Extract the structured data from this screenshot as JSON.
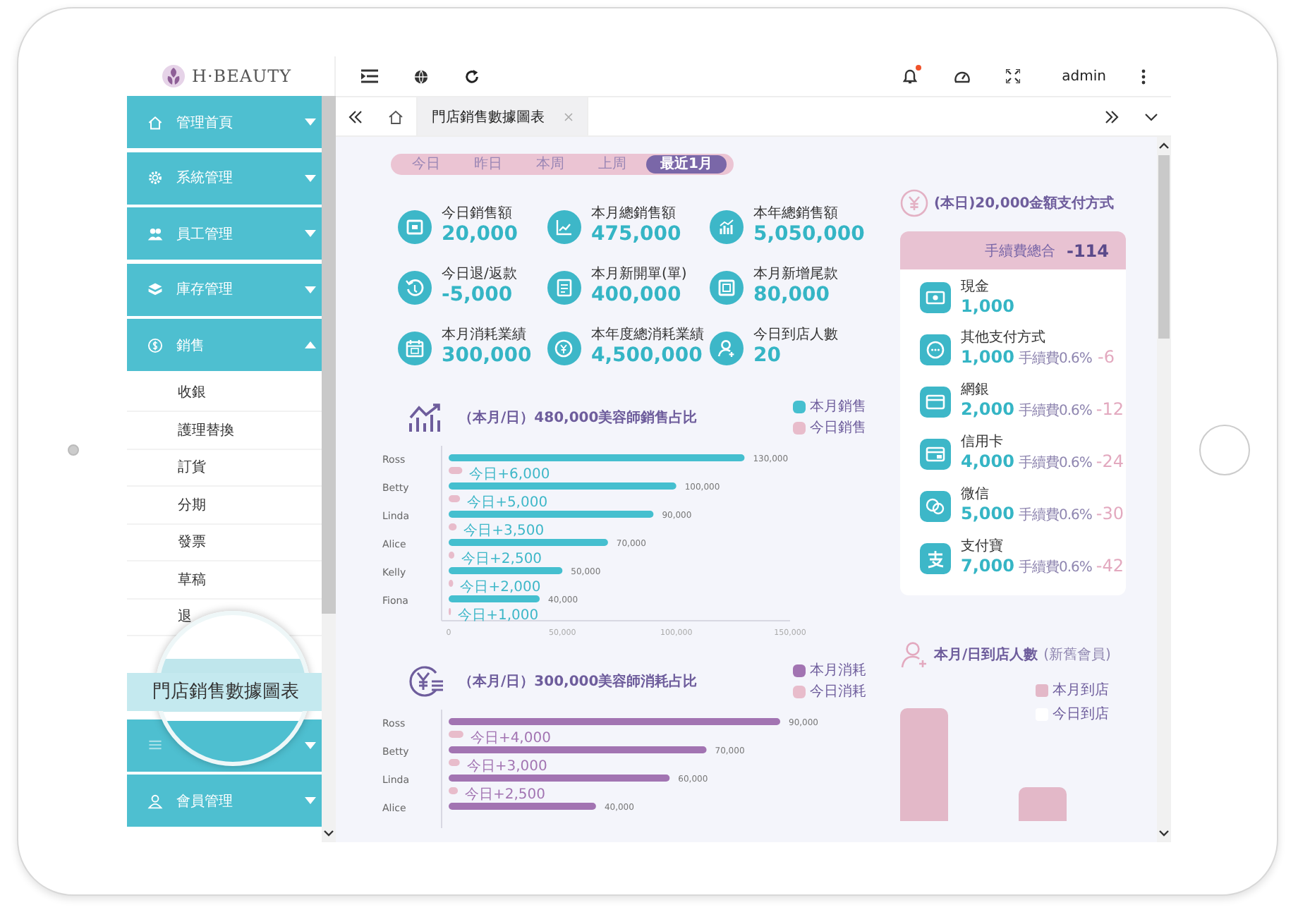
{
  "header": {
    "logo_text": "H·BEAUTY",
    "user": "admin",
    "has_notification": true
  },
  "sidebar": {
    "items": [
      {
        "label": "管理首頁",
        "expanded": false
      },
      {
        "label": "系統管理",
        "expanded": false
      },
      {
        "label": "員工管理",
        "expanded": false
      },
      {
        "label": "庫存管理",
        "expanded": false
      },
      {
        "label": "銷售",
        "expanded": true,
        "children": [
          {
            "label": "收銀",
            "selected": false
          },
          {
            "label": "護理替換",
            "selected": false
          },
          {
            "label": "訂貨",
            "selected": false
          },
          {
            "label": "分期",
            "selected": false
          },
          {
            "label": "發票",
            "selected": false
          },
          {
            "label": "草稿",
            "selected": false
          },
          {
            "label": "退",
            "selected": false
          },
          {
            "label": "門店銷售數據圖表",
            "selected": true
          }
        ]
      },
      {
        "expanded": false
      },
      {
        "label": "會員管理",
        "expanded": false
      }
    ]
  },
  "tabs": [
    {
      "label": "門店銷售數據圖表",
      "selected": true
    }
  ],
  "date_range": [
    {
      "label": "今日",
      "selected": false
    },
    {
      "label": "昨日",
      "selected": false
    },
    {
      "label": "本周",
      "selected": false
    },
    {
      "label": "上周",
      "selected": false
    },
    {
      "label": "最近1月",
      "selected": true
    }
  ],
  "stats": [
    {
      "label": "今日銷售額",
      "value": "20,000"
    },
    {
      "label": "本月總銷售額",
      "value": "475,000"
    },
    {
      "label": "本年總銷售額",
      "value": "5,050,000"
    },
    {
      "label": "今日退/返款",
      "value": "-5,000"
    },
    {
      "label": "本月新開單(單)",
      "value": "400,000"
    },
    {
      "label": "本月新增尾款",
      "value": "80,000"
    },
    {
      "label": "本月消耗業績",
      "value": "300,000"
    },
    {
      "label": "本年度總消耗業績",
      "value": "4,500,000"
    },
    {
      "label": "今日到店人數",
      "value": "20"
    }
  ],
  "sales_chart": {
    "title": "（本月/日）480,000美容師銷售占比",
    "chart_data": {
      "type": "bar",
      "orientation": "horizontal",
      "categories": [
        "Ross",
        "Betty",
        "Linda",
        "Alice",
        "Kelly",
        "Fiona"
      ],
      "series": [
        {
          "name": "本月銷售",
          "color": "#45bfcf",
          "values": [
            130000,
            100000,
            90000,
            70000,
            50000,
            40000
          ],
          "value_labels": [
            "130,000",
            "100,000",
            "90,000",
            "70,000",
            "50,000",
            "40,000"
          ]
        },
        {
          "name": "今日銷售",
          "color": "#e8bccb",
          "values": [
            6000,
            5000,
            3500,
            2500,
            2000,
            1000
          ],
          "value_labels": [
            "今日+6,000",
            "今日+5,000",
            "今日+3,500",
            "今日+2,500",
            "今日+2,000",
            "今日+1,000"
          ]
        }
      ],
      "stacked": false,
      "xlim": [
        0,
        150000
      ],
      "xticks": [
        {
          "value": 0,
          "label": "0"
        },
        {
          "value": 50000,
          "label": "50,000"
        },
        {
          "value": 100000,
          "label": "100,000"
        },
        {
          "value": 150000,
          "label": "150,000"
        }
      ]
    }
  },
  "consumption_chart": {
    "title": "（本月/日）300,000美容師消耗占比",
    "chart_data": {
      "type": "bar",
      "orientation": "horizontal",
      "categories": [
        "Ross",
        "Betty",
        "Linda",
        "Alice"
      ],
      "series": [
        {
          "name": "本月消耗",
          "color": "#a274b2",
          "values": [
            90000,
            70000,
            60000,
            40000
          ],
          "value_labels": [
            "90,000",
            "70,000",
            "60,000",
            "40,000"
          ]
        },
        {
          "name": "今日消耗",
          "color": "#e8bccb",
          "values": [
            4000,
            3000,
            2500,
            null
          ],
          "value_labels": [
            "今日+4,000",
            "今日+3,000",
            "今日+2,500",
            null
          ]
        }
      ]
    }
  },
  "payments": {
    "title": "(本日)20,000金額支付方式",
    "fee_total_label": "手續費總合",
    "fee_total": "-114",
    "rows": [
      {
        "label": "現金",
        "amount": "1,000"
      },
      {
        "label": "其他支付方式",
        "amount": "1,000",
        "fee_label": "手續費0.6%",
        "fee": "-6"
      },
      {
        "label": "網銀",
        "amount": "2,000",
        "fee_label": "手續費0.6%",
        "fee": "-12"
      },
      {
        "label": "信用卡",
        "amount": "4,000",
        "fee_label": "手續費0.6%",
        "fee": "-24"
      },
      {
        "label": "微信",
        "amount": "5,000",
        "fee_label": "手續費0.6%",
        "fee": "-30"
      },
      {
        "label": "支付寶",
        "amount": "7,000",
        "fee_label": "手續費0.6%",
        "fee": "-42"
      }
    ]
  },
  "visitors": {
    "title": "本月/日到店人數",
    "subtitle": "(新舊會員)",
    "legend": [
      {
        "label": "本月到店",
        "color": "#e3b8c8"
      },
      {
        "label": "今日到店",
        "color": "#ffffff"
      }
    ]
  }
}
